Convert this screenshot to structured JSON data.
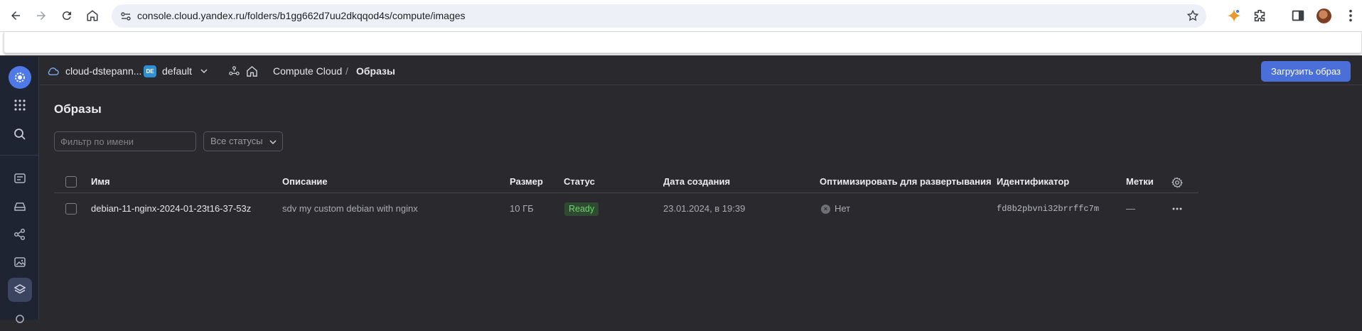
{
  "browser": {
    "url": "console.cloud.yandex.ru/folders/b1gg662d7uu2dkqqod4s/compute/images"
  },
  "topbar": {
    "cloud_name": "cloud-dstepann...",
    "folder_badge": "DE",
    "folder_name": "default",
    "service": "Compute Cloud",
    "separator": "/",
    "current_page": "Образы",
    "upload_button": "Загрузить образ"
  },
  "page": {
    "title": "Образы"
  },
  "filters": {
    "name_placeholder": "Фильтр по имени",
    "status_select": "Все статусы"
  },
  "table": {
    "columns": [
      "Имя",
      "Описание",
      "Размер",
      "Статус",
      "Дата создания",
      "Оптимизировать для развертывания",
      "Идентификатор",
      "Метки"
    ],
    "rows": [
      {
        "name": "debian-11-nginx-2024-01-23t16-37-53z",
        "description": "sdv my custom debian with nginx",
        "size": "10 ГБ",
        "status": "Ready",
        "created": "23.01.2024, в 19:39",
        "optimize": "Нет",
        "id": "fd8b2pbvni32brrffc7m",
        "labels": "—"
      }
    ]
  },
  "colors": {
    "accent": "#4a6fd9",
    "rail_bg": "#1f2433",
    "page_bg": "#2a2a2e",
    "status_ready": "#6fd36f"
  }
}
